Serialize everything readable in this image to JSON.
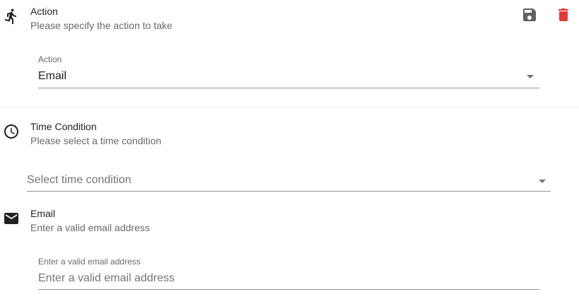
{
  "action_section": {
    "icon": "running-person-icon",
    "title": "Action",
    "subtitle": "Please specify the action to take",
    "save_icon": "save-icon",
    "delete_icon": "delete-icon",
    "field_label": "Action",
    "field_value": "Email"
  },
  "time_section": {
    "icon": "clock-icon",
    "title": "Time Condition",
    "subtitle": "Please select a time condition",
    "select_placeholder": "Select time condition"
  },
  "email_section": {
    "icon": "mail-icon",
    "title": "Email",
    "subtitle": "Enter a valid email address",
    "field_label": "Enter a valid email address",
    "field_placeholder": "Enter a valid email address"
  },
  "colors": {
    "delete": "#e53935",
    "save": "#616161"
  }
}
